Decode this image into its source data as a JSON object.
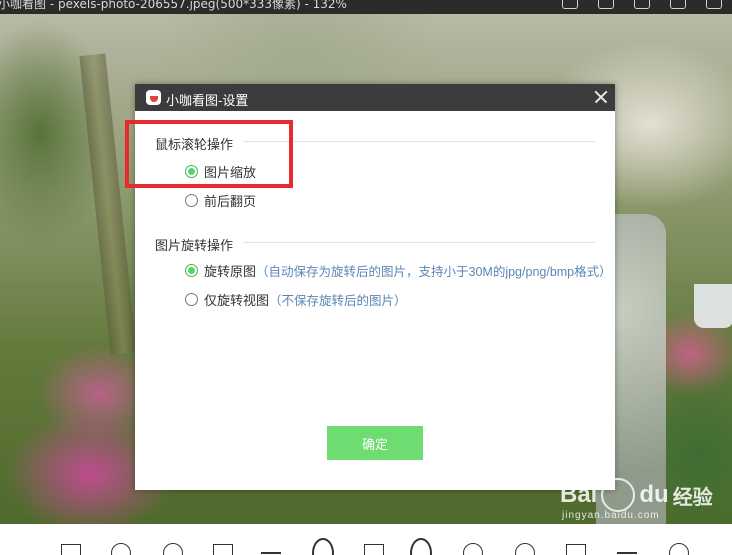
{
  "viewer": {
    "window_title": "小咖看图 - pexels-photo-206557.jpeg(500*333像素) - 132%",
    "top_icons": [
      "export-icon",
      "print-icon",
      "share-icon",
      "settings-gear-icon",
      "window-restore-icon"
    ],
    "bottom_icons": [
      "image-icon",
      "zoom-in-icon",
      "zoom-out-icon",
      "fit-screen-icon",
      "fullscreen-icon",
      "prev-arrow-icon",
      "slideshow-icon",
      "next-arrow-icon",
      "rotate-right-icon",
      "rotate-left-icon",
      "delete-icon",
      "menu-icon",
      "info-icon"
    ]
  },
  "dialog": {
    "title": "小咖看图-设置",
    "section1": {
      "heading": "鼠标滚轮操作",
      "options": [
        {
          "label": "图片缩放",
          "checked": true
        },
        {
          "label": "前后翻页",
          "checked": false
        }
      ]
    },
    "section2": {
      "heading": "图片旋转操作",
      "options": [
        {
          "label": "旋转原图",
          "hint": "（自动保存为旋转后的图片，支持小于30M的jpg/png/bmp格式）",
          "checked": true
        },
        {
          "label": "仅旋转视图",
          "hint": "（不保存旋转后的图片）",
          "checked": false
        }
      ]
    },
    "ok_label": "确定"
  },
  "watermark": {
    "brand": "Bai",
    "brand2": "du",
    "cn": "经验",
    "sub": "jingyan.baidu.com"
  },
  "colors": {
    "title_bar": "#3c3c3c",
    "accent_green": "#6fdc72",
    "hint_blue": "#5b87b5",
    "highlight_red": "#e8292f"
  }
}
